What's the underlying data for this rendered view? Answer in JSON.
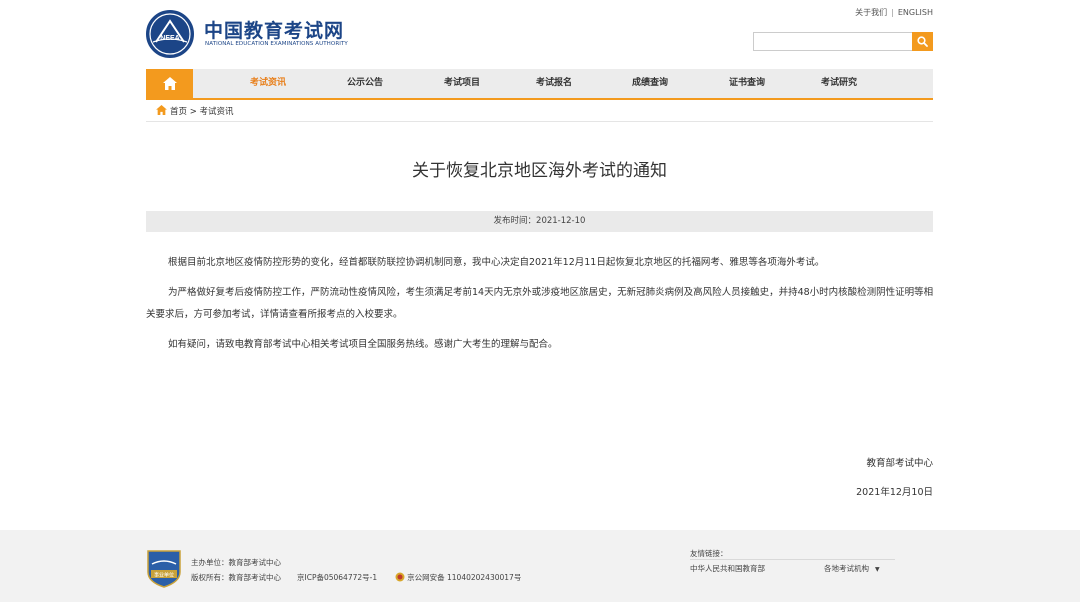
{
  "header": {
    "logo_title": "中国教育考试网",
    "logo_subtitle": "NATIONAL EDUCATION EXAMINATIONS AUTHORITY",
    "logo_mark_text": "NEEA",
    "about_link": "关于我们",
    "separator": "|",
    "english_link": "ENGLISH",
    "search_placeholder": "",
    "search_icon": "search-icon",
    "accent_color": "#f39a1e",
    "brand_color": "#1c4587"
  },
  "nav": {
    "home_icon": "home-icon",
    "items": [
      {
        "label": "考试资讯",
        "active": true
      },
      {
        "label": "公示公告",
        "active": false
      },
      {
        "label": "考试项目",
        "active": false
      },
      {
        "label": "考试报名",
        "active": false
      },
      {
        "label": "成绩查询",
        "active": false
      },
      {
        "label": "证书查询",
        "active": false
      },
      {
        "label": "考试研究",
        "active": false
      }
    ]
  },
  "breadcrumb": {
    "home": "首页",
    "separator": ">",
    "current": "考试资讯"
  },
  "article": {
    "title": "关于恢复北京地区海外考试的通知",
    "publish_label": "发布时间：",
    "publish_date": "2021-12-10",
    "paragraphs": [
      "根据目前北京地区疫情防控形势的变化，经首都联防联控协调机制同意，我中心决定自2021年12月11日起恢复北京地区的托福网考、雅思等各项海外考试。",
      "为严格做好复考后疫情防控工作，严防流动性疫情风险，考生须满足考前14天内无京外或涉疫地区旅居史，无新冠肺炎病例及高风险人员接触史，并持48小时内核酸检测阴性证明等相关要求后，方可参加考试，详情请查看所报考点的入校要求。",
      "如有疑问，请致电教育部考试中心相关考试项目全国服务热线。感谢广大考生的理解与配合。"
    ],
    "signature": "教育部考试中心",
    "signature_date": "2021年12月10日"
  },
  "footer": {
    "sponsor": "主办单位：教育部考试中心",
    "copyright": "版权所有：教育部考试中心",
    "icp": "京ICP备05064772号-1",
    "police": "京公网安备 11040202430017号",
    "badge_text": "事业单位",
    "links_title": "友情链接：",
    "link_moe": "中华人民共和国教育部",
    "link_exam_orgs": "各地考试机构",
    "link_arrow": "▼"
  }
}
